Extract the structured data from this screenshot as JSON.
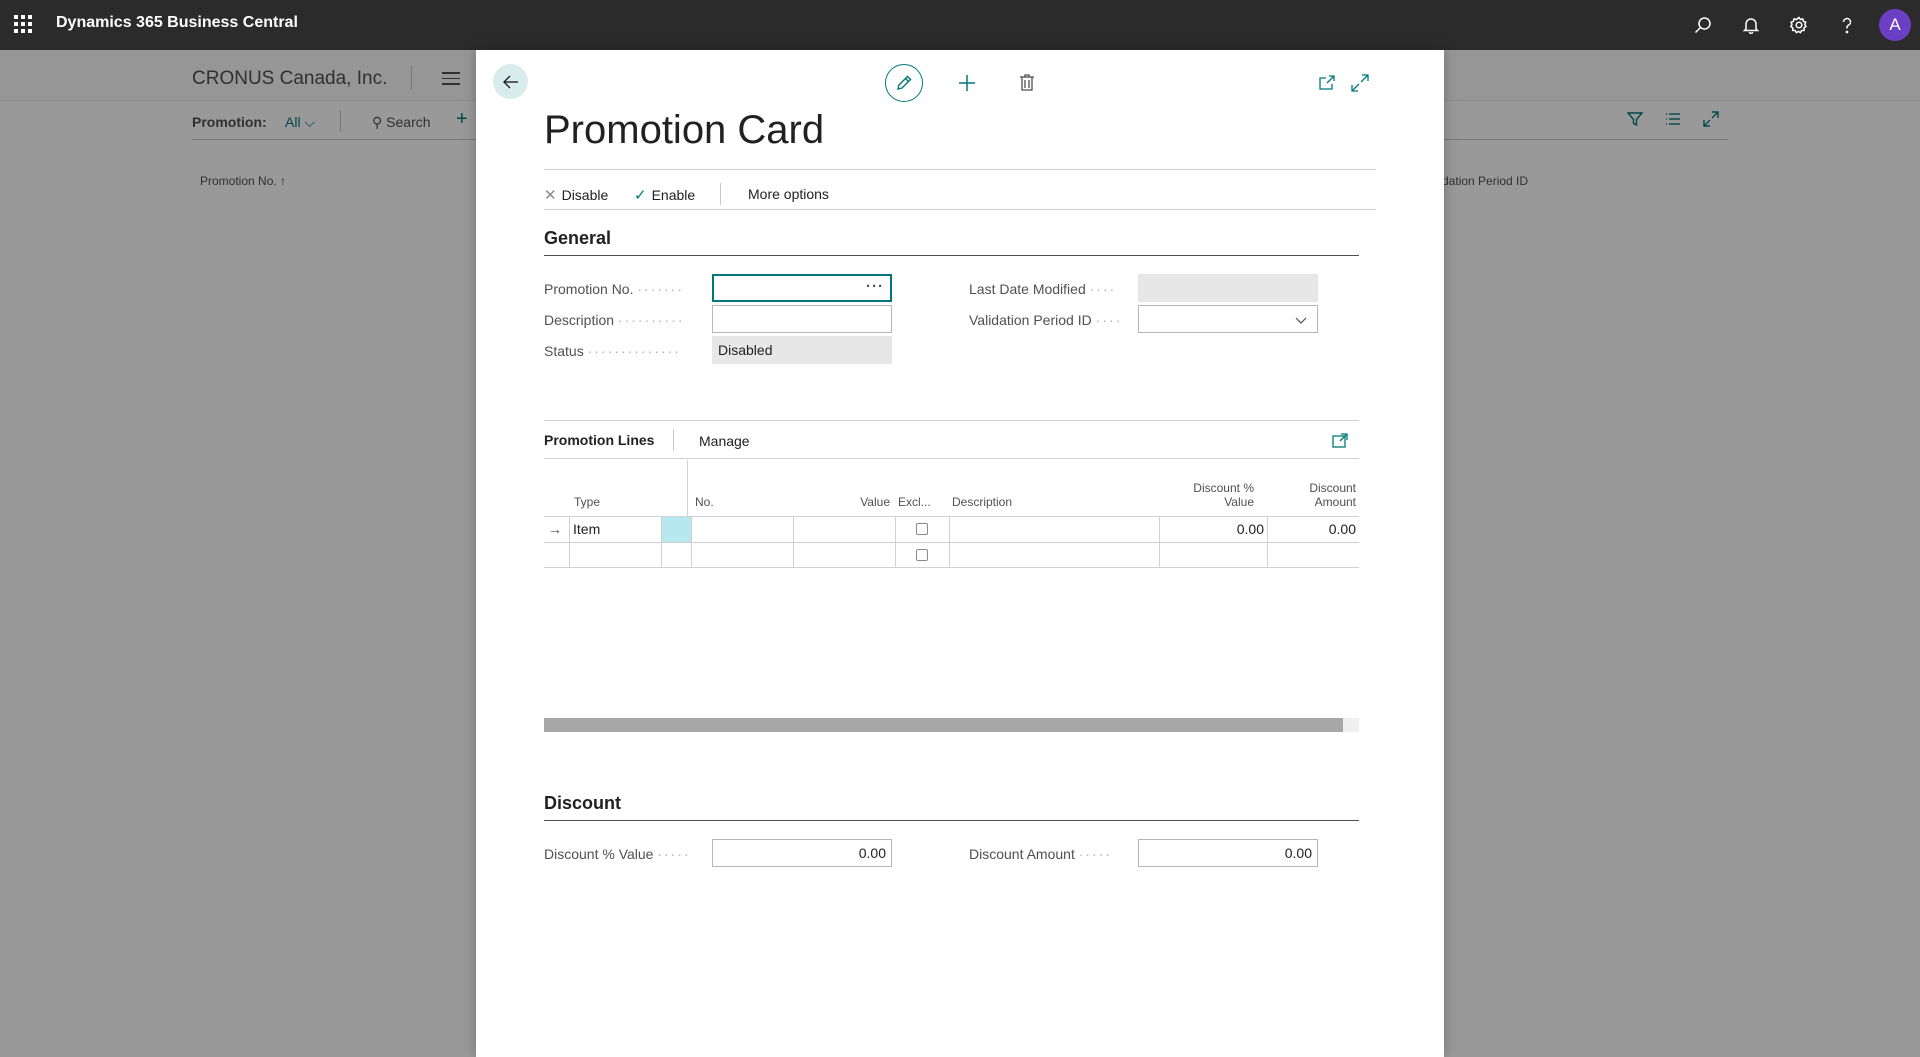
{
  "app": {
    "title": "Dynamics 365 Business Central",
    "avatar_initial": "A",
    "top_icons": [
      "search-icon",
      "bell-icon",
      "gear-icon",
      "help-icon"
    ]
  },
  "background_page": {
    "company": "CRONUS Canada, Inc.",
    "filter_label": "Promotion:",
    "filter_value": "All",
    "search_label": "Search",
    "column_1": "Promotion No. ↑",
    "column_2": "alidation Period ID"
  },
  "dialog": {
    "title": "Promotion Card",
    "actions": {
      "disable": "Disable",
      "enable": "Enable",
      "more": "More options"
    },
    "general": {
      "header": "General",
      "promotion_no_label": "Promotion No.",
      "promotion_no_value": "",
      "description_label": "Description",
      "description_value": "",
      "status_label": "Status",
      "status_value": "Disabled",
      "last_date_modified_label": "Last Date Modified",
      "last_date_modified_value": "",
      "validation_period_label": "Validation Period ID",
      "validation_period_value": ""
    },
    "lines": {
      "title": "Promotion Lines",
      "manage": "Manage",
      "columns": {
        "type": "Type",
        "no": "No.",
        "value": "Value",
        "exclude": "Excl...",
        "description": "Description",
        "discount_pct_1": "Discount %",
        "discount_pct_2": "Value",
        "discount_amt_1": "Discount",
        "discount_amt_2": "Amount"
      },
      "rows": [
        {
          "type": "Item",
          "no": "",
          "value": "",
          "exclude": false,
          "description": "",
          "discount_pct": "0.00",
          "discount_amt": "0.00"
        },
        {
          "type": "",
          "no": "",
          "value": "",
          "exclude": false,
          "description": "",
          "discount_pct": "",
          "discount_amt": ""
        }
      ]
    },
    "discount": {
      "header": "Discount",
      "discount_pct_label": "Discount % Value",
      "discount_pct_value": "0.00",
      "discount_amount_label": "Discount Amount",
      "discount_amount_value": "0.00"
    }
  },
  "colors": {
    "accent": "#00787a",
    "appbar": "#2b2b2b",
    "avatar": "#6b3fc4"
  }
}
